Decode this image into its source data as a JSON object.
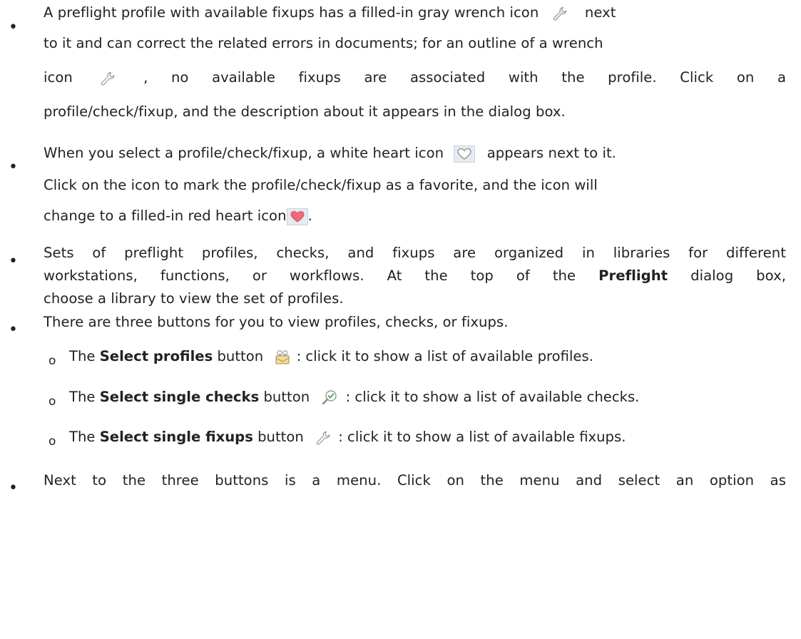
{
  "bullets": [
    {
      "lines": [
        {
          "before": "A preflight profile with available fixups has a filled-in gray wrench icon",
          "after": "next"
        },
        {
          "text": "to it and can correct the related errors in documents; for an outline of a wrench"
        },
        {
          "before": "icon",
          "after": ", no available fixups are associated with the profile. Click on a"
        },
        {
          "text": "profile/check/fixup, and the description about it appears in the dialog box."
        }
      ]
    },
    {
      "lines": [
        {
          "before": "When you select a profile/check/fixup, a white heart icon",
          "after": "appears next to it."
        },
        {
          "text": "Click on the icon to mark the profile/check/fixup as a favorite, and the icon will"
        },
        {
          "before": "change to a filled-in red heart icon",
          "after": "."
        }
      ]
    },
    {
      "lines": [
        {
          "text": "Sets of preflight profiles, checks, and fixups are organized in libraries for different"
        },
        {
          "text": "workstations, functions, or workflows. At the top of the",
          "bold": "Preflight",
          "after": "dialog box,"
        },
        {
          "text": "choose a library to view the set of profiles."
        }
      ]
    },
    {
      "lines": [
        {
          "text": "There are three buttons for you to view profiles, checks, or fixups."
        }
      ]
    },
    {
      "lines": [
        {
          "text": "Next to the three buttons is a menu. Click on the menu and select an option as"
        }
      ]
    }
  ],
  "sub_bullets": [
    {
      "marker": "o",
      "before": "The",
      "bold": "Select profiles",
      "mid": "button",
      "after": ": click it to show a list of available profiles.",
      "icon": "select-profiles-icon"
    },
    {
      "marker": "o",
      "before": "The",
      "bold": "Select single checks",
      "mid": "button",
      "after": ": click it to show a list of available checks.",
      "icon": "select-checks-icon"
    },
    {
      "marker": "o",
      "before": "The",
      "bold": "Select single fixups",
      "mid": "button",
      "after": ": click it to show a list of available fixups.",
      "icon": "wrench-outline-icon"
    }
  ],
  "icons": {
    "wrench_filled": "wrench-filled-icon",
    "wrench_outline": "wrench-outline-icon",
    "heart_white": "heart-outline-icon",
    "heart_red": "heart-filled-icon",
    "heart_red_color": "#f06a78",
    "icon_gray": "#9a9a9a",
    "check_green": "#3aa64a"
  }
}
